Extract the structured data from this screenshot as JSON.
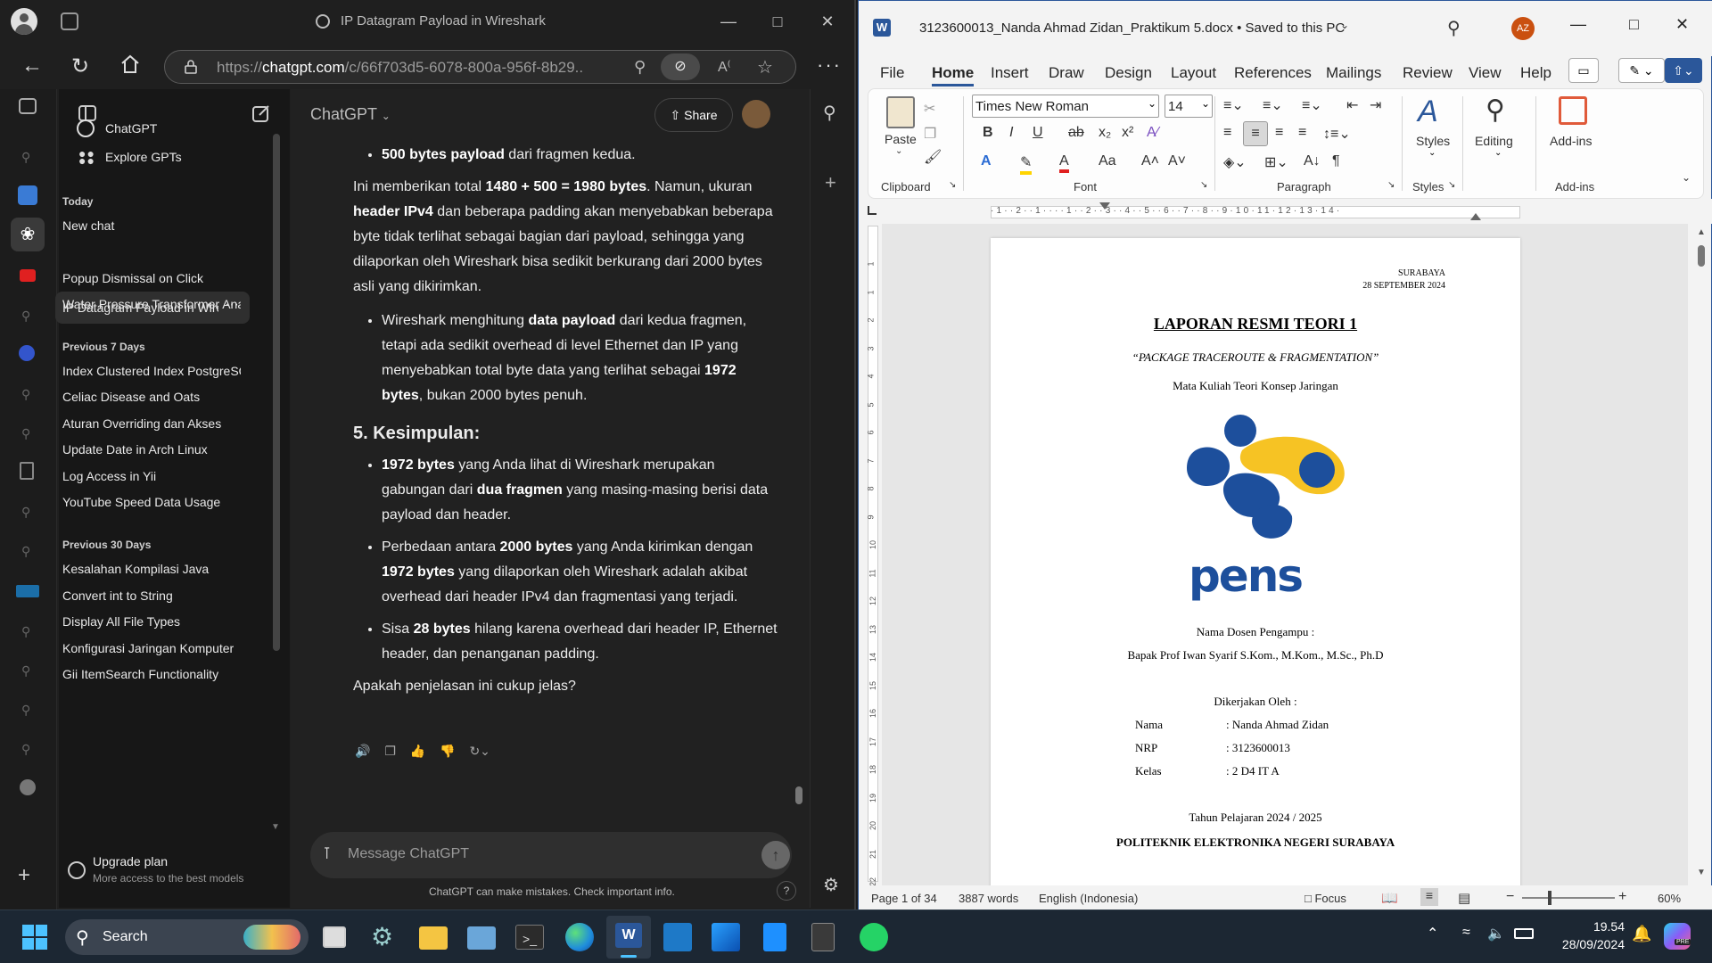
{
  "edge": {
    "tab_title": "IP Datagram Payload in Wireshark",
    "url_prefix": "https://",
    "url_host": "chatgpt.com",
    "url_path": "/c/66f703d5-6078-800a-956f-8b29..."
  },
  "chatgpt": {
    "sidebar": {
      "top_items": [
        "ChatGPT",
        "Explore GPTs"
      ],
      "today_header": "Today",
      "today": [
        "New chat",
        "IP Datagram Payload in Wire",
        "Popup Dismissal on Click",
        "Water Pressure Transformer Ana"
      ],
      "prev7_header": "Previous 7 Days",
      "prev7": [
        "Index Clustered Index PostgreSQ",
        "Celiac Disease and Oats",
        "Aturan Overriding dan Akses",
        "Update Date in Arch Linux",
        "Log Access in Yii",
        "YouTube Speed Data Usage"
      ],
      "prev30_header": "Previous 30 Days",
      "prev30": [
        "Kesalahan Kompilasi Java",
        "Convert int to String",
        "Display All File Types",
        "Konfigurasi Jaringan Komputer",
        "Gii ItemSearch Functionality"
      ],
      "upgrade_title": "Upgrade plan",
      "upgrade_sub": "More access to the best models"
    },
    "header": {
      "model": "ChatGPT",
      "share": "Share"
    },
    "content": {
      "b1_bold": "500 bytes payload",
      "b1_rest": " dari fragmen kedua.",
      "p1_a": "Ini memberikan total ",
      "p1_b": "1480 + 500 = 1980 bytes",
      "p1_c": ". Namun, ukuran ",
      "p1_d": "header IPv4",
      "p1_e": " dan beberapa padding akan menyebabkan beberapa byte tidak terlihat sebagai bagian dari payload, sehingga yang dilaporkan oleh Wireshark bisa sedikit berkurang dari 2000 bytes asli yang dikirimkan.",
      "b2_a": "Wireshark menghitung ",
      "b2_b": "data payload",
      "b2_c": " dari kedua fragmen, tetapi ada sedikit overhead di level Ethernet dan IP yang menyebabkan total byte data yang terlihat sebagai ",
      "b2_d": "1972 bytes",
      "b2_e": ", bukan 2000 bytes penuh.",
      "heading": "5. Kesimpulan:",
      "c1_a": "1972 bytes",
      "c1_b": " yang Anda lihat di Wireshark merupakan gabungan dari ",
      "c1_c": "dua fragmen",
      "c1_d": " yang masing-masing berisi data payload dan header.",
      "c2_a": "Perbedaan antara ",
      "c2_b": "2000 bytes",
      "c2_c": " yang Anda kirimkan dengan ",
      "c2_d": "1972 bytes",
      "c2_e": " yang dilaporkan oleh Wireshark adalah akibat overhead dari header IPv4 dan fragmentasi yang terjadi.",
      "c3_a": "Sisa ",
      "c3_b": "28 bytes",
      "c3_c": " hilang karena overhead dari header IP, Ethernet header, dan penanganan padding.",
      "question": "Apakah penjelasan ini cukup jelas?"
    },
    "input_placeholder": "Message ChatGPT",
    "disclaimer": "ChatGPT can make mistakes. Check important info.",
    "help": "?"
  },
  "word": {
    "title": "3123600013_Nanda Ahmad Zidan_Praktikum 5.docx • Saved to this PC",
    "avatar": "AZ",
    "menu": [
      "File",
      "Home",
      "Insert",
      "Draw",
      "Design",
      "Layout",
      "References",
      "Mailings",
      "Review",
      "View",
      "Help"
    ],
    "font_name": "Times New Roman",
    "font_size": "14",
    "groups": {
      "clipboard": "Clipboard",
      "font": "Font",
      "paragraph": "Paragraph",
      "styles": "Styles",
      "addins": "Add-ins"
    },
    "paste": "Paste",
    "styles_btn": "Styles",
    "editing_btn": "Editing",
    "addins_btn": "Add-ins",
    "ruler_nums": [
      "1",
      "2",
      "1",
      "1",
      "2",
      "3",
      "4",
      "5",
      "6",
      "7",
      "8",
      "9",
      "10",
      "11",
      "12",
      "13",
      "14"
    ],
    "vruler_nums": [
      "1",
      "1",
      "2",
      "3",
      "4",
      "5",
      "6",
      "7",
      "8",
      "9",
      "10",
      "11",
      "12",
      "13",
      "14",
      "15",
      "16",
      "17",
      "18",
      "19",
      "20",
      "21",
      "22"
    ],
    "doc": {
      "city": "SURABAYA",
      "date": "28 SEPTEMBER 2024",
      "title": "LAPORAN RESMI TEORI 1",
      "subtitle": "“PACKAGE TRACEROUTE & FRAGMENTATION”",
      "course": "Mata Kuliah Teori Konsep Jaringan",
      "logo_text": "pens",
      "dosen_label": "Nama Dosen Pengampu :",
      "dosen": "Bapak Prof Iwan Syarif S.Kom., M.Kom., M.Sc., Ph.D",
      "by": "Dikerjakan Oleh :",
      "fields": [
        {
          "label": "Nama",
          "value": ": Nanda Ahmad Zidan"
        },
        {
          "label": "NRP",
          "value": ": 3123600013"
        },
        {
          "label": "Kelas",
          "value": ": 2 D4 IT A"
        }
      ],
      "year": "Tahun Pelajaran 2024 / 2025",
      "institution": "POLITEKNIK ELEKTRONIKA NEGERI SURABAYA"
    },
    "status": {
      "page": "Page 1 of 34",
      "words": "3887 words",
      "lang": "English (Indonesia)",
      "focus": "Focus",
      "zoom": "60%",
      "zoom_level": 0.6
    }
  },
  "taskbar": {
    "search": "Search",
    "time": "19.54",
    "date": "28/09/2024",
    "badge": "PRE"
  },
  "colors": {
    "word_blue": "#2b579a",
    "chat_bg": "#212121",
    "taskbar": "#1c2733",
    "pens_blue": "#1d4f9c",
    "pens_yellow": "#f6c324"
  }
}
